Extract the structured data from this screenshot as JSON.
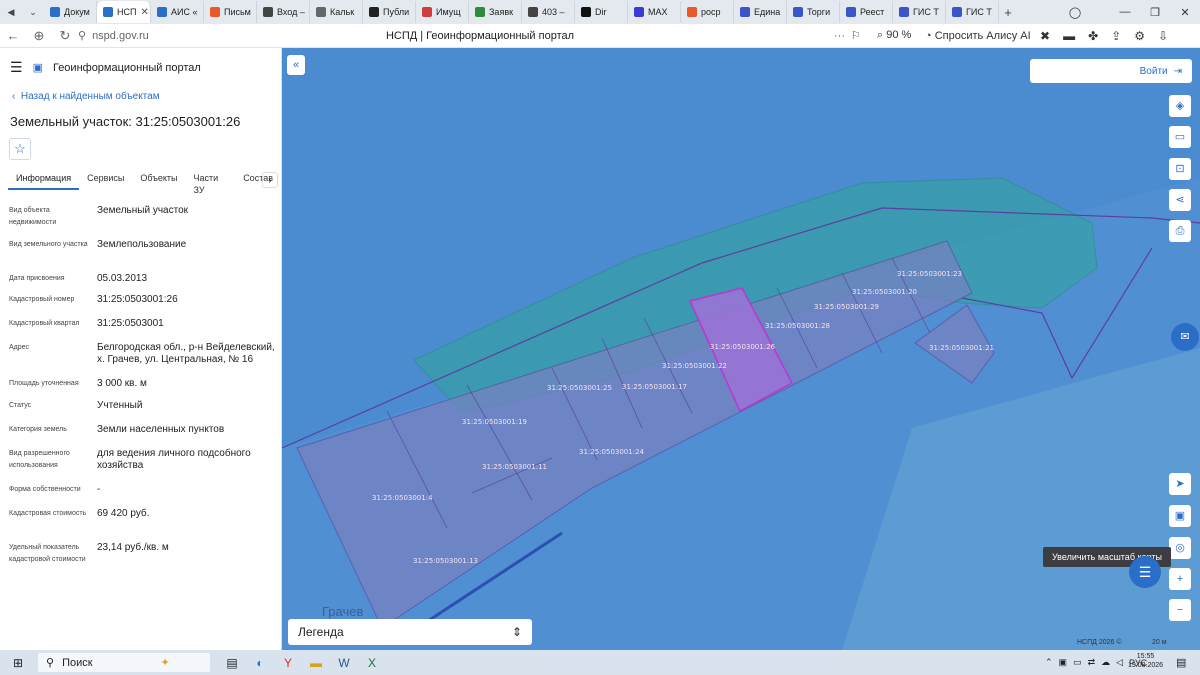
{
  "browser": {
    "tabs": [
      {
        "label": "Докум",
        "color": "#2b6ec7"
      },
      {
        "label": "НСП",
        "color": "#2b6ec7"
      },
      {
        "label": "АИС «",
        "color": "#2b6ec7"
      },
      {
        "label": "Письм",
        "color": "#e85a25"
      },
      {
        "label": "Вход –",
        "color": "#444444"
      },
      {
        "label": "Кальк",
        "color": "#666666"
      },
      {
        "label": "Публи",
        "color": "#222222"
      },
      {
        "label": "Имущ",
        "color": "#d13b3b"
      },
      {
        "label": "Заявк",
        "color": "#2c8c3c"
      },
      {
        "label": "403 –",
        "color": "#444444"
      },
      {
        "label": "Dir",
        "color": "#111111"
      },
      {
        "label": "MAX",
        "color": "#3a3ad9"
      },
      {
        "label": "роср",
        "color": "#e85a25"
      },
      {
        "label": "Едина",
        "color": "#3b55c8"
      },
      {
        "label": "Торги",
        "color": "#3b55c8"
      },
      {
        "label": "Реест",
        "color": "#3b55c8"
      },
      {
        "label": "ГИС Т",
        "color": "#3b55c8"
      },
      {
        "label": "ГИС Т",
        "color": "#3b55c8"
      }
    ],
    "url": "nspd.gov.ru",
    "page_title": "НСПД | Геоинформационный портал",
    "zoom": "90 %",
    "alisa": "Спросить Алису AI"
  },
  "panel": {
    "portal_title": "Геоинформационный портал",
    "back_link": "Назад к найденным объектам",
    "title": "Земельный участок: 31:25:0503001:26",
    "tabs": [
      "Информация",
      "Сервисы",
      "Объекты",
      "Части ЗУ",
      "Состав"
    ],
    "props": [
      {
        "label": "Вид объекта недвижимости",
        "value": "Земельный участок"
      },
      {
        "label": "Вид земельного участка",
        "value": "Землепользование"
      },
      {
        "label": "Дата присвоения",
        "value": "05.03.2013"
      },
      {
        "label": "Кадастровый номер",
        "value": "31:25:0503001:26"
      },
      {
        "label": "Кадастровый квартал",
        "value": "31:25:0503001"
      },
      {
        "label": "Адрес",
        "value": "Белгородская обл., р-н Вейделевский, х. Грачев, ул. Центральная, № 16"
      },
      {
        "label": "Площадь уточненная",
        "value": "3 000 кв. м"
      },
      {
        "label": "Статус",
        "value": "Учтенный"
      },
      {
        "label": "Категория земель",
        "value": "Земли населенных пунктов"
      },
      {
        "label": "Вид разрешенного использования",
        "value": "для ведения личного подсобного хозяйства"
      },
      {
        "label": "Форма собственности",
        "value": "-"
      },
      {
        "label": "Кадастровая стоимость",
        "value": "69 420 руб."
      },
      {
        "label": "Удельный показатель кадастровой стоимости",
        "value": "23,14 руб./кв. м"
      }
    ]
  },
  "map": {
    "login": "Войти",
    "tooltip": "Увеличить масштаб карты",
    "legend": "Легенда",
    "copyright": "НСПД 2026 ©",
    "scale": "20 м",
    "place_name": "Грачев",
    "parcels": [
      "31:25:0503001:23",
      "31:25:0503001:20",
      "31:25:0503001:29",
      "31:25:0503001:28",
      "31:25:0503001:21",
      "31:25:0503001:26",
      "31:25:0503001:22",
      "31:25:0503001:25",
      "31:25:0503001:17",
      "31:25:0503001:19",
      "31:25:0503001:24",
      "31:25:0503001:11",
      "31:25:0503001:4",
      "31:25:0503001:13"
    ]
  },
  "taskbar": {
    "search": "Поиск",
    "lang": "РУС",
    "time": "15:55",
    "date": "19.08.2026"
  }
}
